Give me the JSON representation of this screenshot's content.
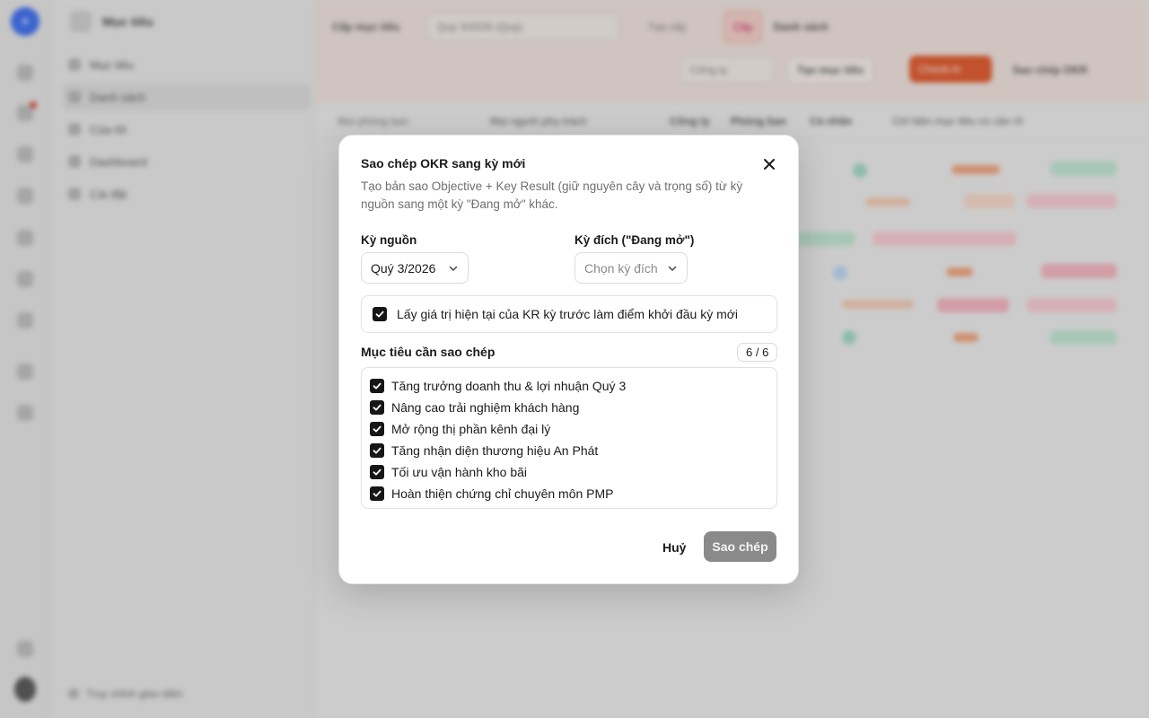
{
  "background": {
    "sidebar_title": "Mục tiêu",
    "sidebar_items": [
      "Mục tiêu",
      "Danh sách",
      "Của tôi",
      "Dashboard",
      "Cài đặt"
    ],
    "sidebar_footer": "Truy chỉnh giao diện",
    "topbar": {
      "cycle_label": "Cấp mục tiêu",
      "cycle_select": "Quý 3/2026 (Quý)",
      "btn_tree": "Tạo cây",
      "btn_chart": "Cây",
      "btn_list": "Danh sách",
      "level_select": "Công ty",
      "btn_new": "Tạo mục tiêu",
      "btn_checkin": "Check-in",
      "btn_copy_okr": "Sao chép OKR"
    },
    "filters": [
      "Mọi phòng ban",
      "Mọi người phụ trách",
      "Công ty",
      "Phòng ban",
      "Cá nhân",
      "Chỉ hiện mục tiêu có cần rõ"
    ]
  },
  "modal": {
    "title": "Sao chép OKR sang kỳ mới",
    "description": "Tạo bản sao Objective + Key Result (giữ nguyên cây và trọng số) từ kỳ nguồn sang một kỳ \"Đang mở\" khác.",
    "source_label": "Kỳ nguồn",
    "source_value": "Quý 3/2026",
    "target_label": "Kỳ đích (\"Đang mở\")",
    "target_placeholder": "Chọn kỳ đích",
    "carry_over_label": "Lấy giá trị hiện tại của KR kỳ trước làm điểm khởi đầu kỳ mới",
    "objectives_label": "Mục tiêu cần sao chép",
    "objectives_count": "6 / 6",
    "objectives": [
      "Tăng trưởng doanh thu & lợi nhuận Quý 3",
      "Nâng cao trải nghiệm khách hàng",
      "Mở rộng thị phần kênh đại lý",
      "Tăng nhận diện thương hiệu An Phát",
      "Tối ưu vận hành kho bãi",
      "Hoàn thiện chứng chỉ chuyên môn PMP"
    ],
    "cancel_label": "Huỷ",
    "submit_label": "Sao chép"
  },
  "colors": {
    "accent_orange": "#e0562a",
    "check_fill": "#161616",
    "submit_disabled": "#8a8a8a"
  }
}
